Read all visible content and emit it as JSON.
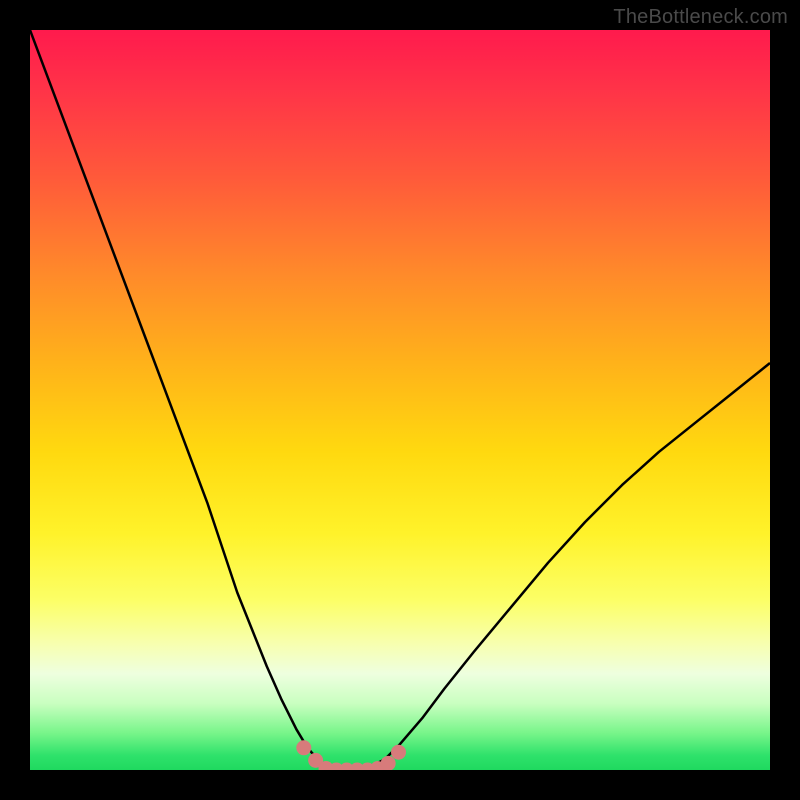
{
  "attribution": "TheBottleneck.com",
  "colors": {
    "frame": "#000000",
    "curve": "#000000",
    "marker": "#d77b7b",
    "gradient_top": "#ff1a4d",
    "gradient_bottom": "#1fd95f"
  },
  "chart_data": {
    "type": "line",
    "title": "",
    "xlabel": "",
    "ylabel": "",
    "xlim": [
      0,
      100
    ],
    "ylim": [
      0,
      100
    ],
    "x": [
      0,
      3,
      6,
      9,
      12,
      15,
      18,
      21,
      24,
      26,
      28,
      30,
      32,
      34,
      36,
      37.5,
      39,
      40.5,
      42,
      44,
      46,
      48,
      50,
      53,
      56,
      60,
      65,
      70,
      75,
      80,
      85,
      90,
      95,
      100
    ],
    "y": [
      100,
      92,
      84,
      76,
      68,
      60,
      52,
      44,
      36,
      30,
      24,
      19,
      14,
      9.5,
      5.5,
      3,
      1.3,
      0.4,
      0,
      0,
      0.4,
      1.5,
      3.5,
      7,
      11,
      16,
      22,
      28,
      33.5,
      38.5,
      43,
      47,
      51,
      55
    ],
    "flat_bottom_markers_x": [
      37.0,
      38.6,
      40.0,
      41.4,
      42.8,
      44.2,
      45.6,
      47.0,
      48.4,
      49.8
    ],
    "flat_bottom_markers_y": [
      3.0,
      1.3,
      0.2,
      0.0,
      0.0,
      0.0,
      0.0,
      0.2,
      0.9,
      2.4
    ],
    "curve_right_endpoint_y": 55
  }
}
